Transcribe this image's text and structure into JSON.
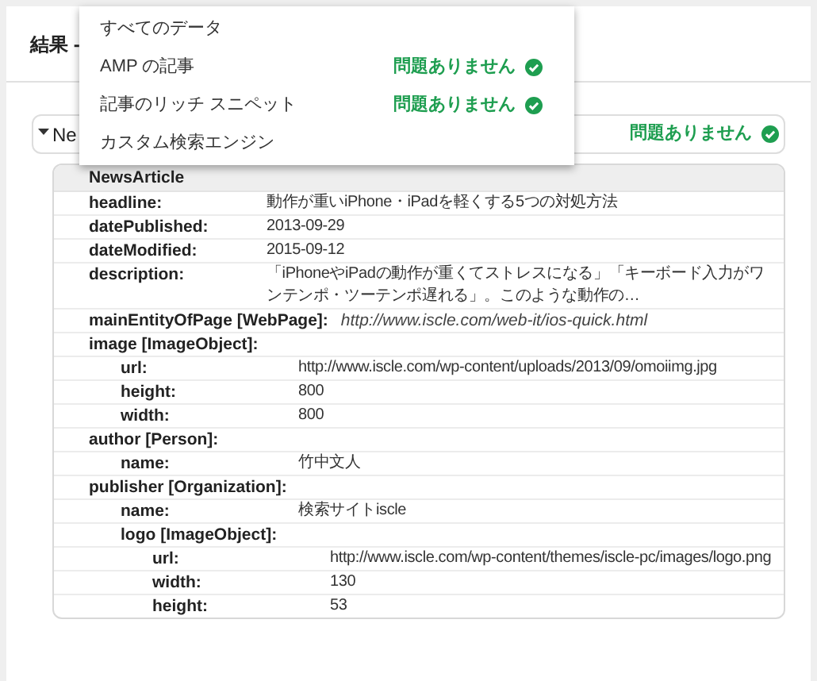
{
  "header": {
    "title": "結果 -"
  },
  "menu": {
    "items": [
      {
        "label": "すべてのデータ"
      },
      {
        "label": "AMP の記事",
        "status": "問題ありません"
      },
      {
        "label": "記事のリッチ スニペット",
        "status": "問題ありません"
      },
      {
        "label": "カスタム検索エンジン"
      }
    ]
  },
  "card": {
    "title": "Ne",
    "expanded": true,
    "status": "問題ありません"
  },
  "table": {
    "type": "NewsArticle",
    "rows": [
      {
        "key": "headline:",
        "value": "動作が重いiPhone・iPadを軽くする5つの対処方法"
      },
      {
        "key": "datePublished:",
        "value": "2013-09-29"
      },
      {
        "key": "dateModified:",
        "value": "2015-09-12"
      },
      {
        "key": "description:",
        "value": "「iPhoneやiPadの動作が重くてストレスになる」「キーボード入力がワンテンポ・ツーテンポ遅れる」。このような動作の…"
      },
      {
        "key": "mainEntityOfPage [WebPage]:",
        "value": "http://www.iscle.com/web-it/ios-quick.html",
        "kind": "inline"
      },
      {
        "key": "image [ImageObject]:",
        "children": [
          {
            "key": "url:",
            "value": "http://www.iscle.com/wp-content/uploads/2013/09/omoiimg.jpg"
          },
          {
            "key": "height:",
            "value": "800"
          },
          {
            "key": "width:",
            "value": "800"
          }
        ]
      },
      {
        "key": "author [Person]:",
        "children": [
          {
            "key": "name:",
            "value": "竹中文人"
          }
        ]
      },
      {
        "key": "publisher [Organization]:",
        "children": [
          {
            "key": "name:",
            "value": "検索サイトiscle"
          },
          {
            "key": "logo [ImageObject]:",
            "children": [
              {
                "key": "url:",
                "value": "http://www.iscle.com/wp-content/themes/iscle-pc/images/logo.png"
              },
              {
                "key": "width:",
                "value": "130"
              },
              {
                "key": "height:",
                "value": "53"
              }
            ]
          }
        ]
      }
    ]
  }
}
